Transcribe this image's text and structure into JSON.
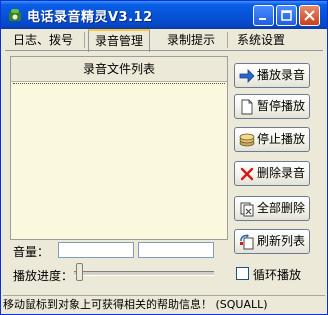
{
  "window": {
    "title": "电话录音精灵V3.12"
  },
  "tabs": [
    {
      "label": "日志、拨号",
      "active": false
    },
    {
      "label": "录音管理",
      "active": true
    },
    {
      "label": "录制提示",
      "active": false
    },
    {
      "label": "系统设置",
      "active": false
    }
  ],
  "list": {
    "header": "录音文件列表"
  },
  "buttons": {
    "play": "播放录音",
    "pause": "暂停播放",
    "stop": "停止播放",
    "delete": "删除录音",
    "delete_all": "全部删除",
    "refresh": "刷新列表"
  },
  "volume": {
    "label": "音量："
  },
  "progress": {
    "label": "播放进度：",
    "value": 0
  },
  "loop": {
    "label": "循环播放",
    "checked": false
  },
  "status": {
    "text": "移动鼠标到对象上可获得相关的帮助信息！  (SQUALL)"
  },
  "colors": {
    "titlebar": "#0553d8",
    "list_bg": "#fbf9dd",
    "active_tab_accent": "#ffc83c"
  }
}
